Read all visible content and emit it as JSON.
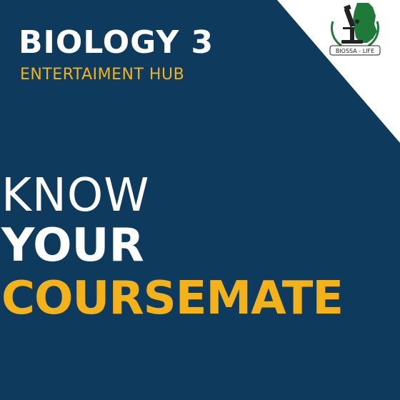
{
  "header": {
    "title": "BIOLOGY 3",
    "subtitle": "ENTERTAIMENT HUB"
  },
  "headline": {
    "line1": "KNOW",
    "line2": "YOUR",
    "line3": "COURSEMATE"
  },
  "logo": {
    "text": "BIOSSA - LIFE"
  },
  "colors": {
    "background": "#0e3a5e",
    "accent": "#f3b21a",
    "text": "#ffffff",
    "corner": "#ffffff"
  }
}
